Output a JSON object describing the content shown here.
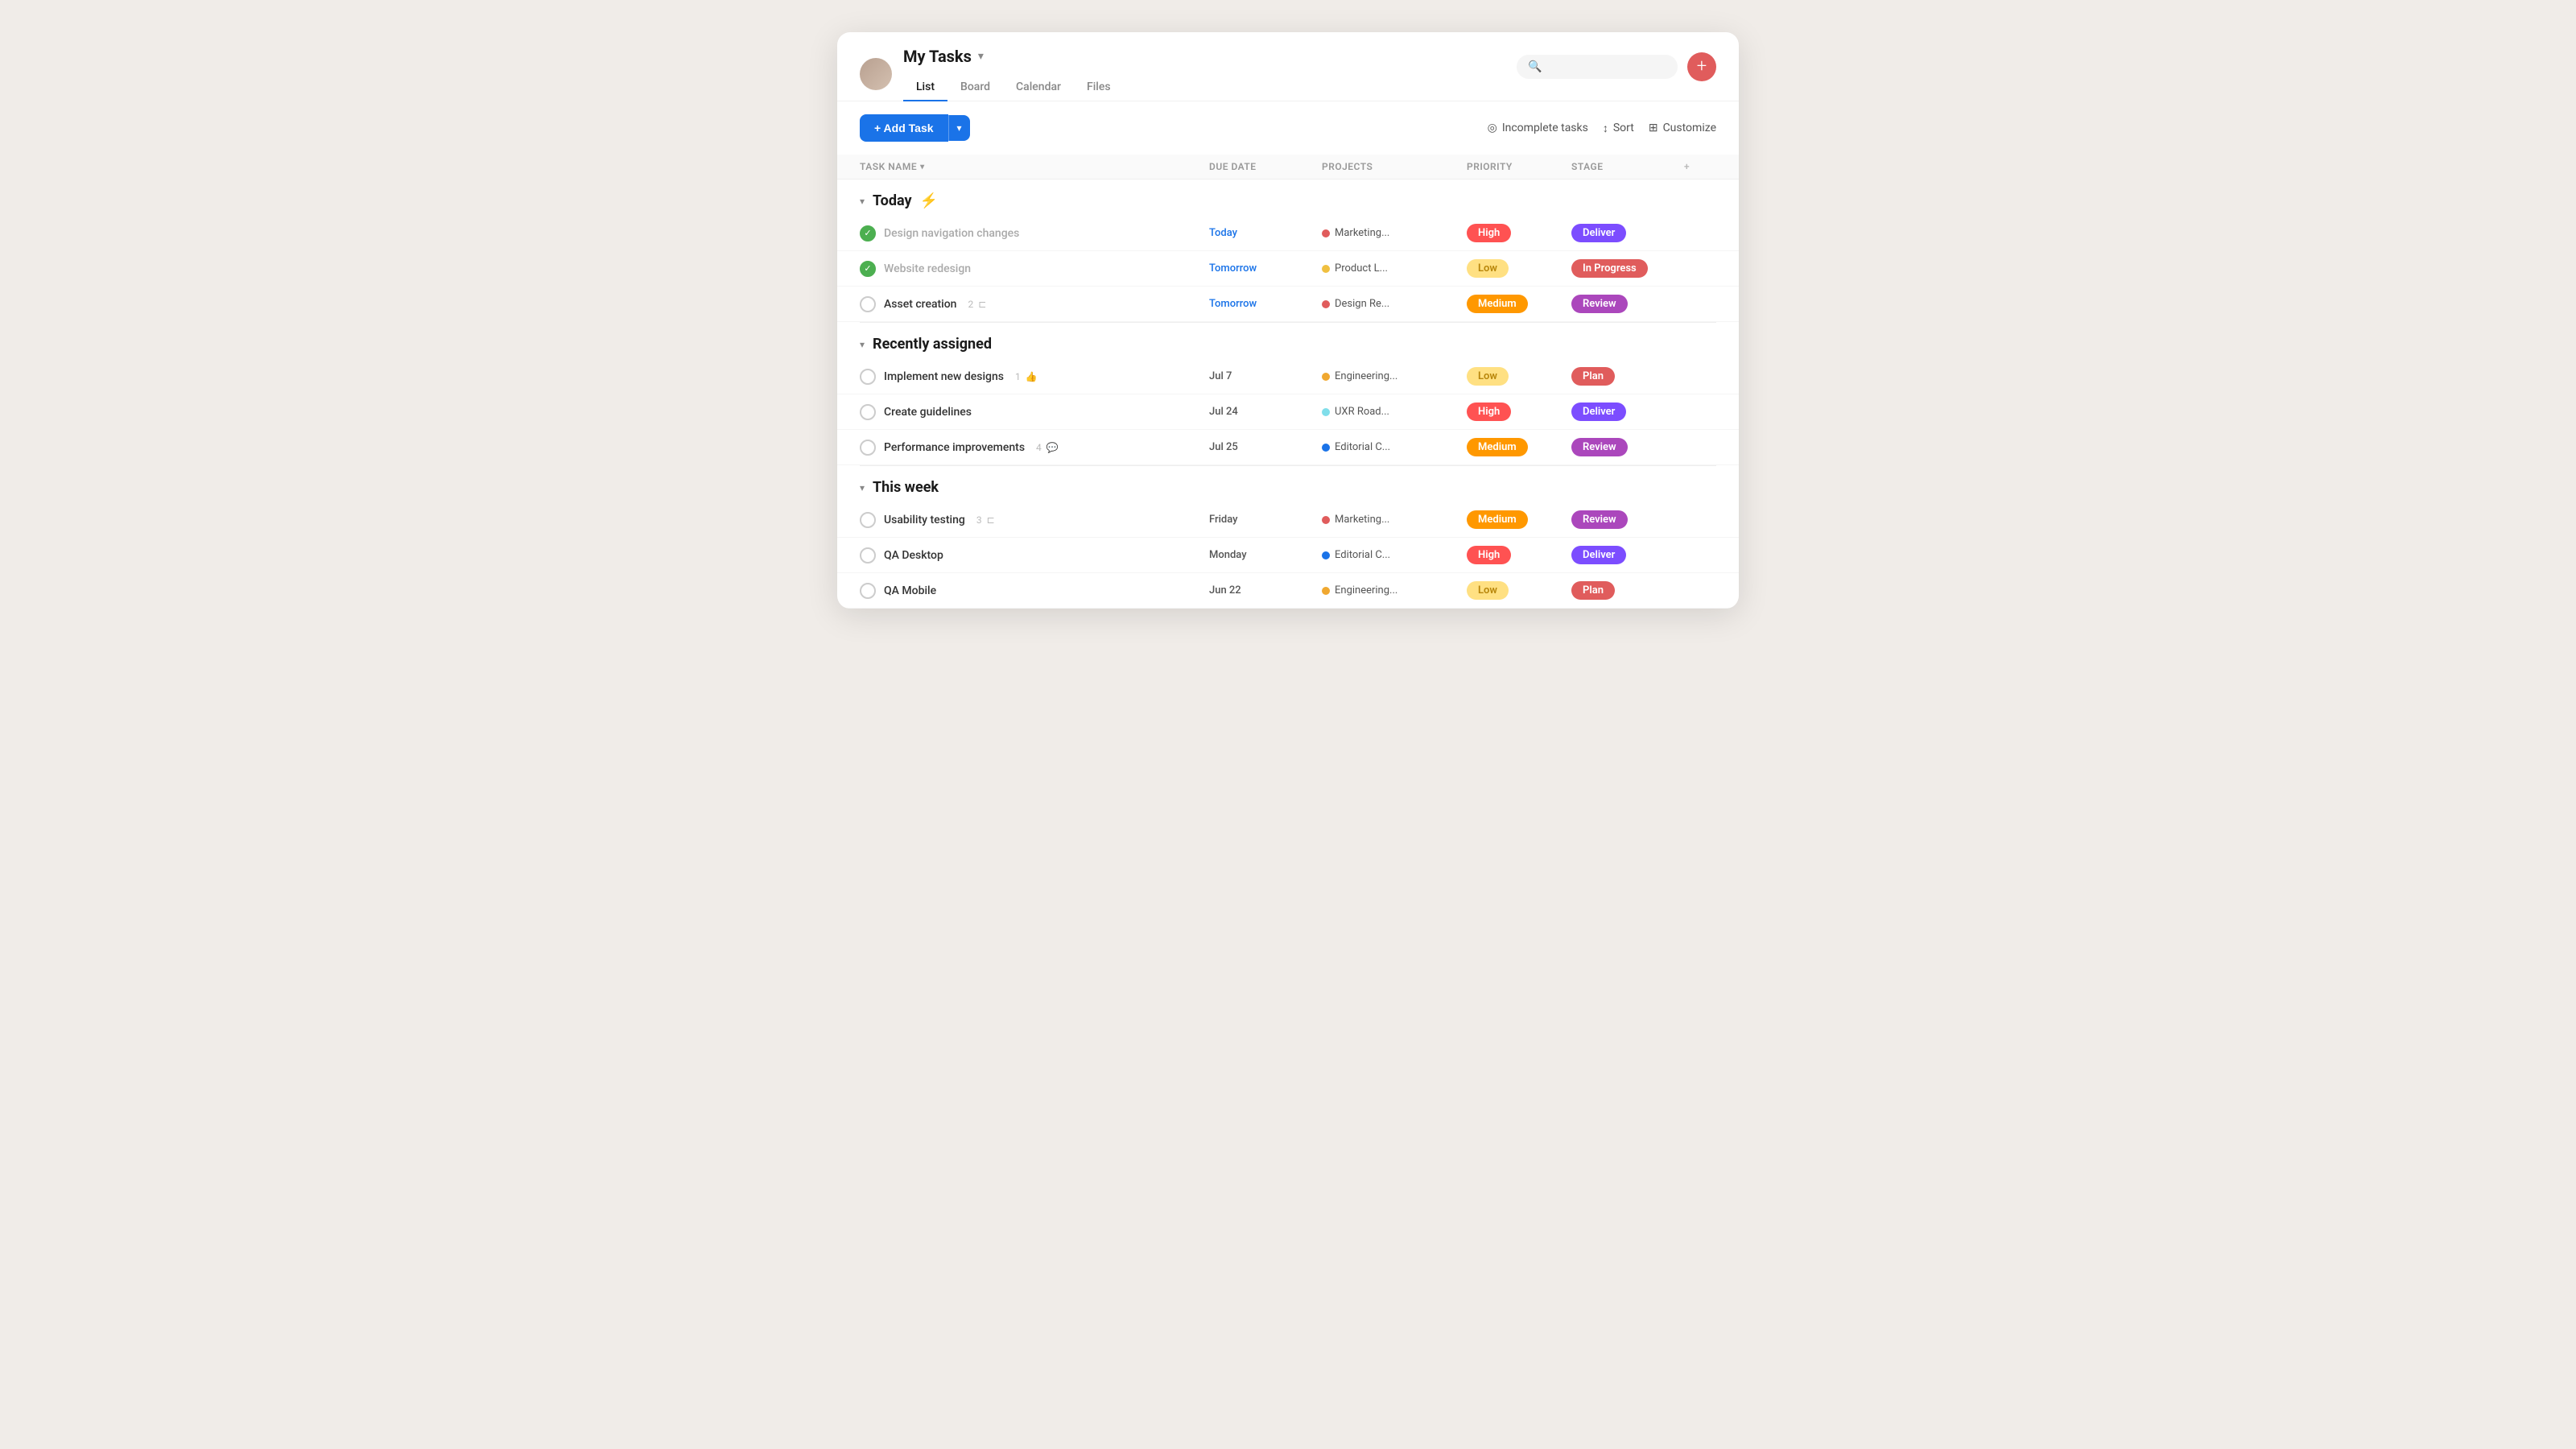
{
  "header": {
    "title": "My Tasks",
    "avatar_alt": "User avatar",
    "nav_tabs": [
      {
        "label": "List",
        "active": true
      },
      {
        "label": "Board",
        "active": false
      },
      {
        "label": "Calendar",
        "active": false
      },
      {
        "label": "Files",
        "active": false
      }
    ],
    "search_placeholder": "Search",
    "plus_icon": "+"
  },
  "toolbar": {
    "add_task_label": "+ Add Task",
    "dropdown_icon": "▾",
    "incomplete_tasks_label": "Incomplete tasks",
    "sort_label": "Sort",
    "customize_label": "Customize"
  },
  "table": {
    "columns": [
      "Task name",
      "Due date",
      "Projects",
      "Priority",
      "Stage",
      "+"
    ]
  },
  "sections": [
    {
      "title": "Today",
      "emoji": "⚡",
      "tasks": [
        {
          "name": "Design navigation changes",
          "completed": true,
          "due_date": "Today",
          "due_color": "blue",
          "project": "Marketing...",
          "project_color": "#e05c5c",
          "priority": "High",
          "priority_class": "priority-high",
          "stage": "Deliver",
          "stage_class": "stage-deliver",
          "meta": null
        },
        {
          "name": "Website redesign",
          "completed": true,
          "due_date": "Tomorrow",
          "due_color": "blue",
          "project": "Product L...",
          "project_color": "#f0c040",
          "priority": "Low",
          "priority_class": "priority-low",
          "stage": "In Progress",
          "stage_class": "stage-in-progress",
          "meta": null
        },
        {
          "name": "Asset creation",
          "completed": false,
          "due_date": "Tomorrow",
          "due_color": "blue",
          "project": "Design Re...",
          "project_color": "#e05c5c",
          "priority": "Medium",
          "priority_class": "priority-medium",
          "stage": "Review",
          "stage_class": "stage-review",
          "meta": {
            "count": "2",
            "icon": "subtask"
          }
        }
      ]
    },
    {
      "title": "Recently assigned",
      "emoji": null,
      "tasks": [
        {
          "name": "Implement new designs",
          "completed": false,
          "due_date": "Jul 7",
          "due_color": "normal",
          "project": "Engineering...",
          "project_color": "#f0a830",
          "priority": "Low",
          "priority_class": "priority-low",
          "stage": "Plan",
          "stage_class": "stage-plan",
          "meta": {
            "count": "1",
            "icon": "like"
          }
        },
        {
          "name": "Create guidelines",
          "completed": false,
          "due_date": "Jul 24",
          "due_color": "normal",
          "project": "UXR Road...",
          "project_color": "#80deea",
          "priority": "High",
          "priority_class": "priority-high",
          "stage": "Deliver",
          "stage_class": "stage-deliver",
          "meta": null
        },
        {
          "name": "Performance improvements",
          "completed": false,
          "due_date": "Jul 25",
          "due_color": "normal",
          "project": "Editorial C...",
          "project_color": "#1a73e8",
          "priority": "Medium",
          "priority_class": "priority-medium",
          "stage": "Review",
          "stage_class": "stage-review",
          "meta": {
            "count": "4",
            "icon": "comment"
          }
        }
      ]
    },
    {
      "title": "This week",
      "emoji": null,
      "tasks": [
        {
          "name": "Usability testing",
          "completed": false,
          "due_date": "Friday",
          "due_color": "normal",
          "project": "Marketing...",
          "project_color": "#e05c5c",
          "priority": "Medium",
          "priority_class": "priority-medium",
          "stage": "Review",
          "stage_class": "stage-review",
          "meta": {
            "count": "3",
            "icon": "subtask"
          }
        },
        {
          "name": "QA Desktop",
          "completed": false,
          "due_date": "Monday",
          "due_color": "normal",
          "project": "Editorial C...",
          "project_color": "#1a73e8",
          "priority": "High",
          "priority_class": "priority-high",
          "stage": "Deliver",
          "stage_class": "stage-deliver",
          "meta": null
        },
        {
          "name": "QA Mobile",
          "completed": false,
          "due_date": "Jun 22",
          "due_color": "normal",
          "project": "Engineering...",
          "project_color": "#f0a830",
          "priority": "Low",
          "priority_class": "priority-low",
          "stage": "Plan",
          "stage_class": "stage-plan",
          "meta": null
        }
      ]
    }
  ]
}
